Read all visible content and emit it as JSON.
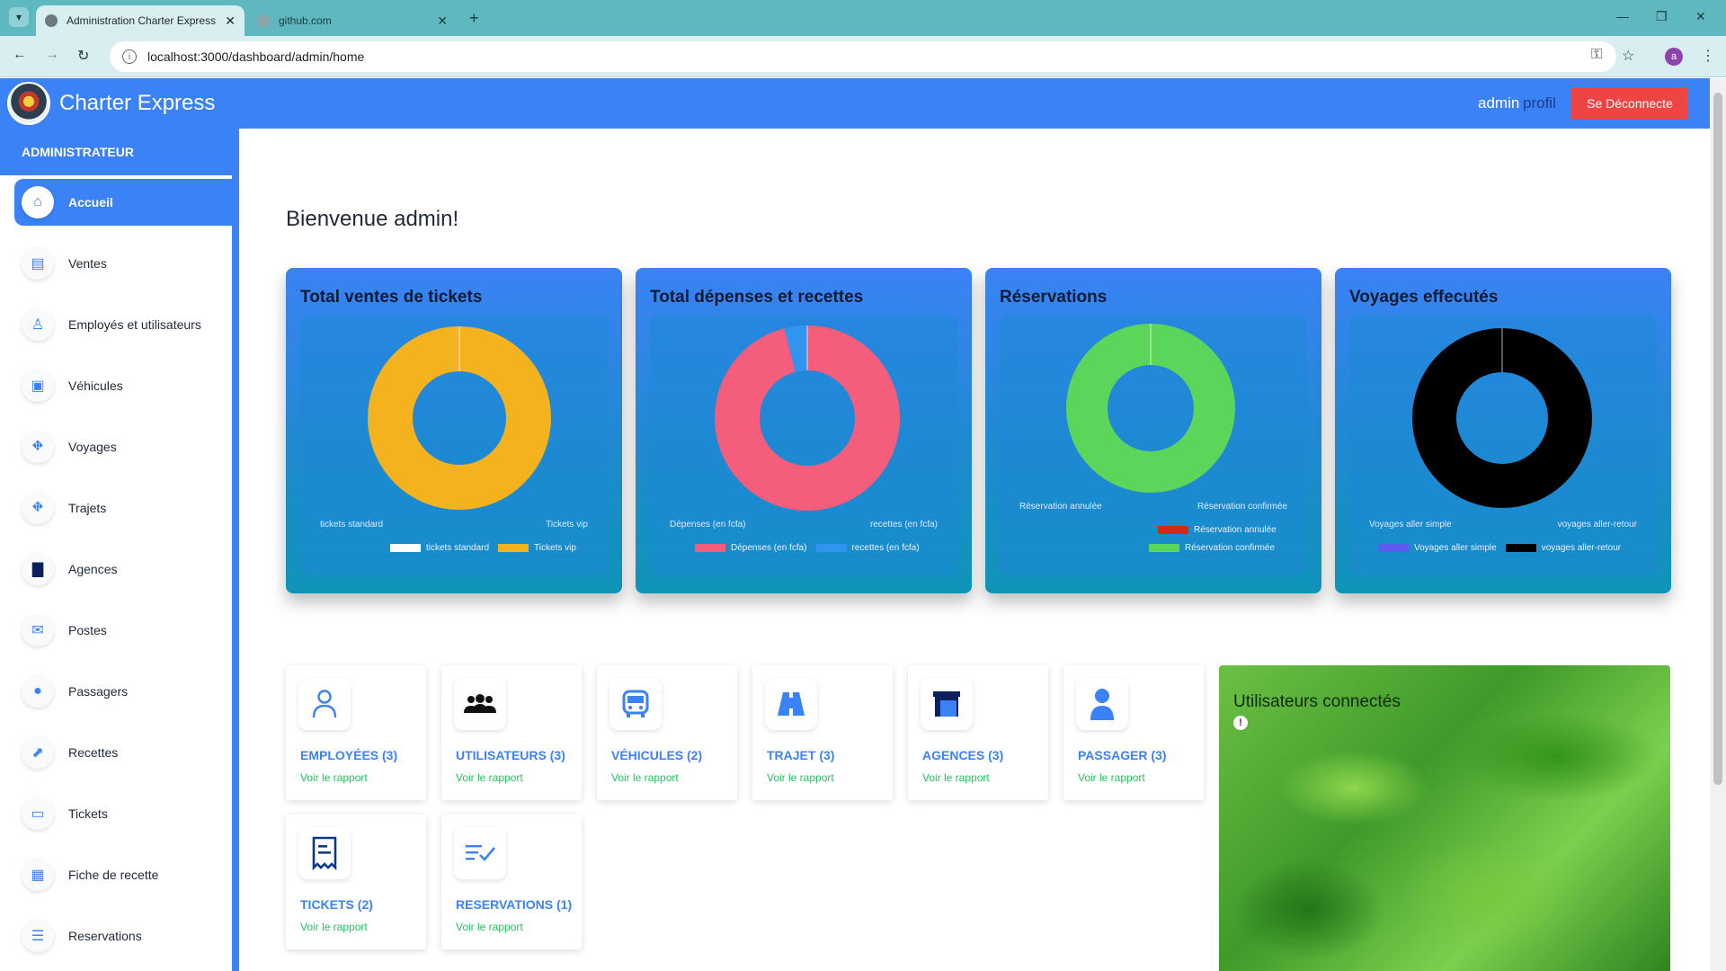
{
  "browser": {
    "tabs": [
      {
        "title": "Administration Charter Express",
        "active": true
      },
      {
        "title": "github.com",
        "active": false
      }
    ],
    "url": "localhost:3000/dashboard/admin/home",
    "profile_initial": "a"
  },
  "header": {
    "brand": "Charter Express",
    "user": "admin",
    "profile_link": "profil",
    "logout": "Se Déconnecte"
  },
  "sidebar": {
    "section": "ADMINISTRATEUR",
    "items": [
      {
        "label": "Accueil",
        "icon": "home-icon",
        "active": true
      },
      {
        "label": "Ventes",
        "icon": "receipt-icon"
      },
      {
        "label": "Employés et utilisateurs",
        "icon": "user-icon"
      },
      {
        "label": "Véhicules",
        "icon": "bus-icon"
      },
      {
        "label": "Voyages",
        "icon": "road-icon"
      },
      {
        "label": "Trajets",
        "icon": "road-icon"
      },
      {
        "label": "Agences",
        "icon": "store-icon"
      },
      {
        "label": "Postes",
        "icon": "mailbox-icon"
      },
      {
        "label": "Passagers",
        "icon": "person-icon"
      },
      {
        "label": "Recettes",
        "icon": "revenue-icon"
      },
      {
        "label": "Tickets",
        "icon": "ticket-icon"
      },
      {
        "label": "Fiche de recette",
        "icon": "sheet-icon"
      },
      {
        "label": "Reservations",
        "icon": "checklist-icon"
      }
    ]
  },
  "main": {
    "welcome": "Bienvenue admin!",
    "stats": [
      {
        "label": "EMPLOYÉES (3)",
        "link": "Voir le rapport",
        "icon": "user-icon"
      },
      {
        "label": "UTILISATEURS (3)",
        "link": "Voir le rapport",
        "icon": "users-icon"
      },
      {
        "label": "VÉHICULES (2)",
        "link": "Voir le rapport",
        "icon": "bus-icon"
      },
      {
        "label": "TRAJET (3)",
        "link": "Voir le rapport",
        "icon": "road-icon"
      },
      {
        "label": "AGENCES (3)",
        "link": "Voir le rapport",
        "icon": "store-icon"
      },
      {
        "label": "PASSAGER (3)",
        "link": "Voir le rapport",
        "icon": "person-icon"
      },
      {
        "label": "TICKETS (2)",
        "link": "Voir le rapport",
        "icon": "ticket-icon"
      },
      {
        "label": "RESERVATIONS (1)",
        "link": "Voir le rapport",
        "icon": "checklist-icon"
      }
    ],
    "connected_panel": {
      "title": "Utilisateurs connectés"
    }
  },
  "chart_data": [
    {
      "type": "pie",
      "title": "Total ventes de tickets",
      "categories": [
        "tickets standard",
        "Tickets vip"
      ],
      "values": [
        0,
        100
      ],
      "colors": [
        "#ffffff",
        "#f5b21f"
      ],
      "legend": "bottom"
    },
    {
      "type": "pie",
      "title": "Total dépenses et recettes",
      "categories": [
        "Dépenses  (en fcfa)",
        "recettes (en fcfa)"
      ],
      "values": [
        96,
        4
      ],
      "colors": [
        "#f55d7c",
        "#2f95ee"
      ],
      "legend": "bottom"
    },
    {
      "type": "pie",
      "title": "Réservations",
      "categories": [
        "Réservation annulée",
        "Réservation confirmée"
      ],
      "values": [
        0,
        100
      ],
      "colors": [
        "#d42a12",
        "#5cd65a"
      ],
      "legend": "bottom"
    },
    {
      "type": "pie",
      "title": "Voyages effecutés",
      "categories": [
        "Voyages aller simple",
        "voyages aller-retour"
      ],
      "values": [
        0,
        100
      ],
      "colors": [
        "#5b5bf0",
        "#000000"
      ],
      "legend": "bottom"
    }
  ]
}
